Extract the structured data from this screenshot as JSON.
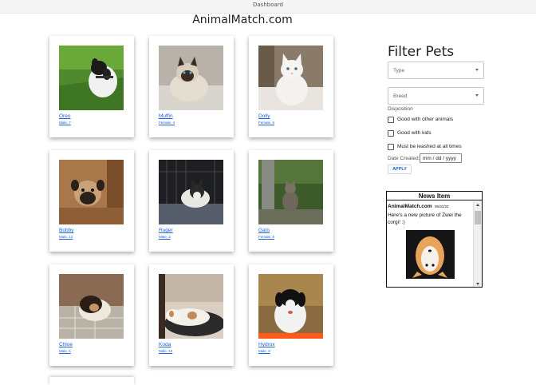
{
  "window": {
    "title": "Dashboard"
  },
  "site": {
    "title": "AnimalMatch.com"
  },
  "pets": [
    {
      "name": "Oreo",
      "info": "Male, 7",
      "photo": "dog-on-grass"
    },
    {
      "name": "Muffin",
      "info": "Female, 4",
      "photo": "siamese-cat"
    },
    {
      "name": "Dolly",
      "info": "Female, 5",
      "photo": "white-kitten"
    },
    {
      "name": "Bobby",
      "info": "Male, 12",
      "photo": "pug"
    },
    {
      "name": "Ruger",
      "info": "Male, 3",
      "photo": "husky-in-crate"
    },
    {
      "name": "Gato",
      "info": "Female, 6",
      "photo": "cat-by-tree"
    },
    {
      "name": "Chloe",
      "info": "Male, 5",
      "photo": "chihuahua-on-blanket"
    },
    {
      "name": "Koda",
      "info": "Male, 10",
      "photo": "dog-sleeping"
    },
    {
      "name": "Hydrox",
      "info": "Male, 9",
      "photo": "dog-in-field"
    }
  ],
  "filter": {
    "title": "Filter Pets",
    "type_placeholder": "Type",
    "breed_placeholder": "Breed",
    "disposition_label": "Disposition",
    "options": [
      "Good with other animals",
      "Good with kids",
      "Must be leashed at all times"
    ],
    "date_label": "Date Created:",
    "date_value": "mm / dd / yyyy",
    "apply_label": "APPLY"
  },
  "news": {
    "title": "News Item",
    "site": "AnimalMatch.com",
    "date": "05/31/22",
    "text": "Here's a new picture of Zwei the corgi! :)",
    "photo": "corgi-upside-down"
  },
  "colors": {
    "link": "#1a62d6",
    "card_shadow": "#9a9a9a",
    "border": "#111111"
  }
}
